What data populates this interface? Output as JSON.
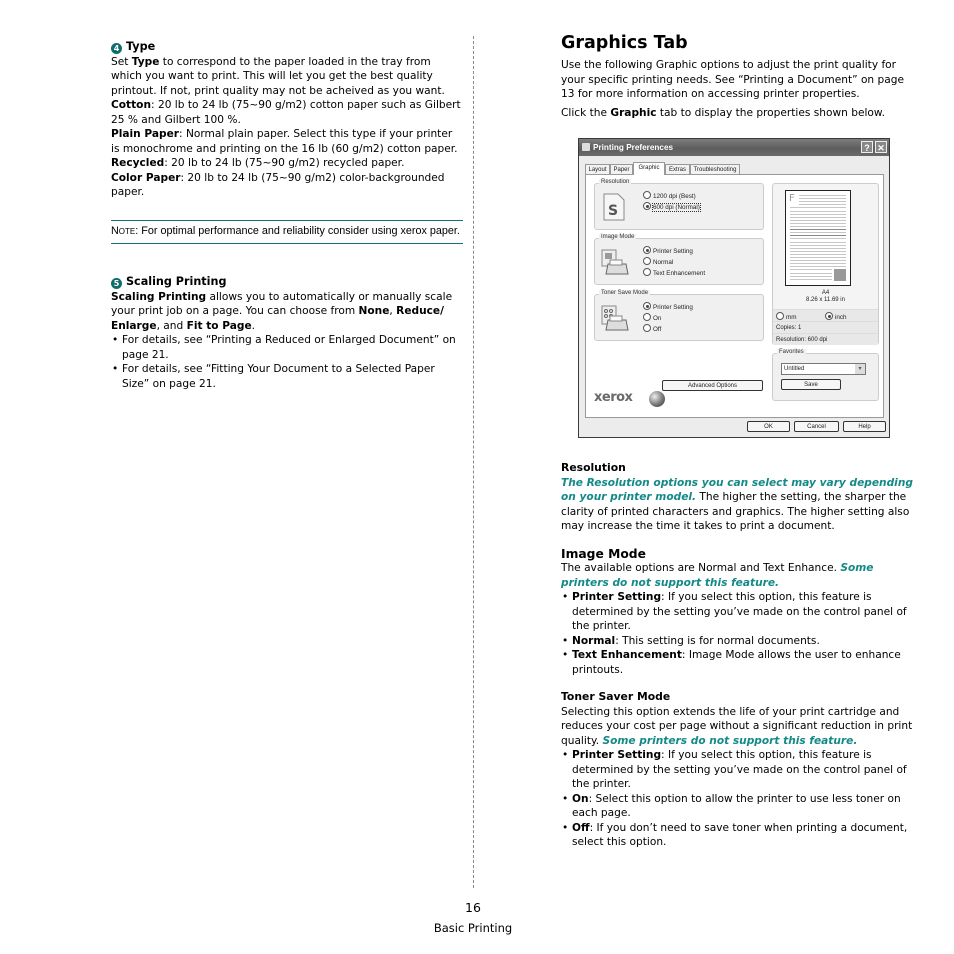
{
  "left": {
    "type_section": {
      "number": "4",
      "heading": "Type",
      "intro_prefix": "Set ",
      "intro_bold": "Type",
      "intro_rest": " to correspond to the paper loaded in the tray from which you want to print. This will let you get the best quality printout. If not, print quality may not be acheived as you want.",
      "items": [
        {
          "term": "Cotton",
          "desc": ": 20 lb to 24 lb (75~90 g/m2) cotton paper such as Gilbert 25 % and Gilbert 100 %."
        },
        {
          "term": "Plain Paper",
          "desc": ": Normal plain paper. Select this type if your printer is monochrome and printing on the 16 lb (60 g/m2) cotton paper."
        },
        {
          "term": "Recycled",
          "desc": ": 20 lb to 24 lb (75~90 g/m2) recycled paper."
        },
        {
          "term": "Color Paper",
          "desc": ": 20 lb to 24 lb (75~90 g/m2) color-backgrounded paper."
        }
      ]
    },
    "note": {
      "label": "Note",
      "text": ": For optimal performance and reliability consider using xerox paper."
    },
    "scaling_section": {
      "number": "5",
      "heading": "Scaling Printing",
      "intro_bold": "Scaling Printing",
      "intro_mid": " allows you to automatically or manually scale your print job on a page. You can choose from ",
      "opt1": "None",
      "sep1": ", ",
      "opt2": "Reduce/ Enlarge",
      "sep2": ", and ",
      "opt3": "Fit to Page",
      "end": ".",
      "bullets": [
        "For details, see “Printing a Reduced or Enlarged Document” on page 21.",
        "For details, see “Fitting Your Document to a Selected Paper Size” on page 21."
      ]
    }
  },
  "right": {
    "title": "Graphics Tab",
    "intro": "Use the following Graphic options to adjust the print quality for your specific printing needs. See “Printing a Document” on page 13 for more information on accessing printer properties.",
    "click_prefix": "Click the ",
    "click_bold": "Graphic",
    "click_rest": " tab to display the properties shown below.",
    "resolution": {
      "heading": "Resolution",
      "teal": "The Resolution options you can select may vary depending on your printer model.",
      "rest": " The higher the setting, the sharper the clarity of printed characters and graphics. The higher setting also may increase the time it takes to print a document."
    },
    "image_mode": {
      "heading": "Image Mode",
      "intro": "The available options are Normal and Text Enhance. ",
      "teal": "Some printers do not support this feature.",
      "bullets": [
        {
          "term": "Printer Setting",
          "desc": ": If you select this option, this feature is determined by the setting you’ve made on the control panel of the printer."
        },
        {
          "term": "Normal",
          "desc": ": This setting is for normal documents."
        },
        {
          "term": "Text Enhancement",
          "desc": ": Image Mode allows the user to enhance printouts."
        }
      ]
    },
    "toner": {
      "heading": "Toner Saver Mode",
      "intro": "Selecting this option extends the life of your print cartridge and reduces your cost per page without a significant reduction in print quality. ",
      "teal": "Some printers do not support this feature.",
      "bullets": [
        {
          "term": "Printer Setting",
          "desc": ": If you select this option, this feature is determined by the setting you’ve made on the control panel of the printer."
        },
        {
          "term": "On",
          "desc": ": Select this option to allow the printer to use less toner on each page."
        },
        {
          "term": "Off",
          "desc": ": If you don’t need to save toner when printing a document, select this option."
        }
      ]
    }
  },
  "dialog": {
    "title": "Printing Preferences",
    "help_btn": "?",
    "close_btn": "✕",
    "tabs": [
      "Layout",
      "Paper",
      "Graphic",
      "Extras",
      "Troubleshooting"
    ],
    "active_tab": "Graphic",
    "resolution": {
      "label": "Resolution",
      "options": [
        "1200 dpi (Best)",
        "600 dpi (Normal)"
      ],
      "selected": 1
    },
    "image_mode": {
      "label": "Image Mode",
      "options": [
        "Printer Setting",
        "Normal",
        "Text Enhancement"
      ],
      "selected": 0
    },
    "toner_save": {
      "label": "Toner Save Mode",
      "options": [
        "Printer Setting",
        "On",
        "Off"
      ],
      "selected": 0
    },
    "preview": {
      "page_letter": "F",
      "paper": "A4",
      "size": "8.26 x 11.69 in",
      "units": [
        "mm",
        "inch"
      ],
      "unit_selected": 1,
      "copies": "Copies: 1",
      "resolution": "Resolution: 600 dpi"
    },
    "favorites": {
      "label": "Favorites",
      "value": "Untitled",
      "save": "Save"
    },
    "advanced_options": "Advanced Options",
    "brand": "xerox",
    "buttons": {
      "ok": "OK",
      "cancel": "Cancel",
      "help": "Help"
    }
  },
  "footer": {
    "page_number": "16",
    "chapter": "Basic Printing"
  }
}
